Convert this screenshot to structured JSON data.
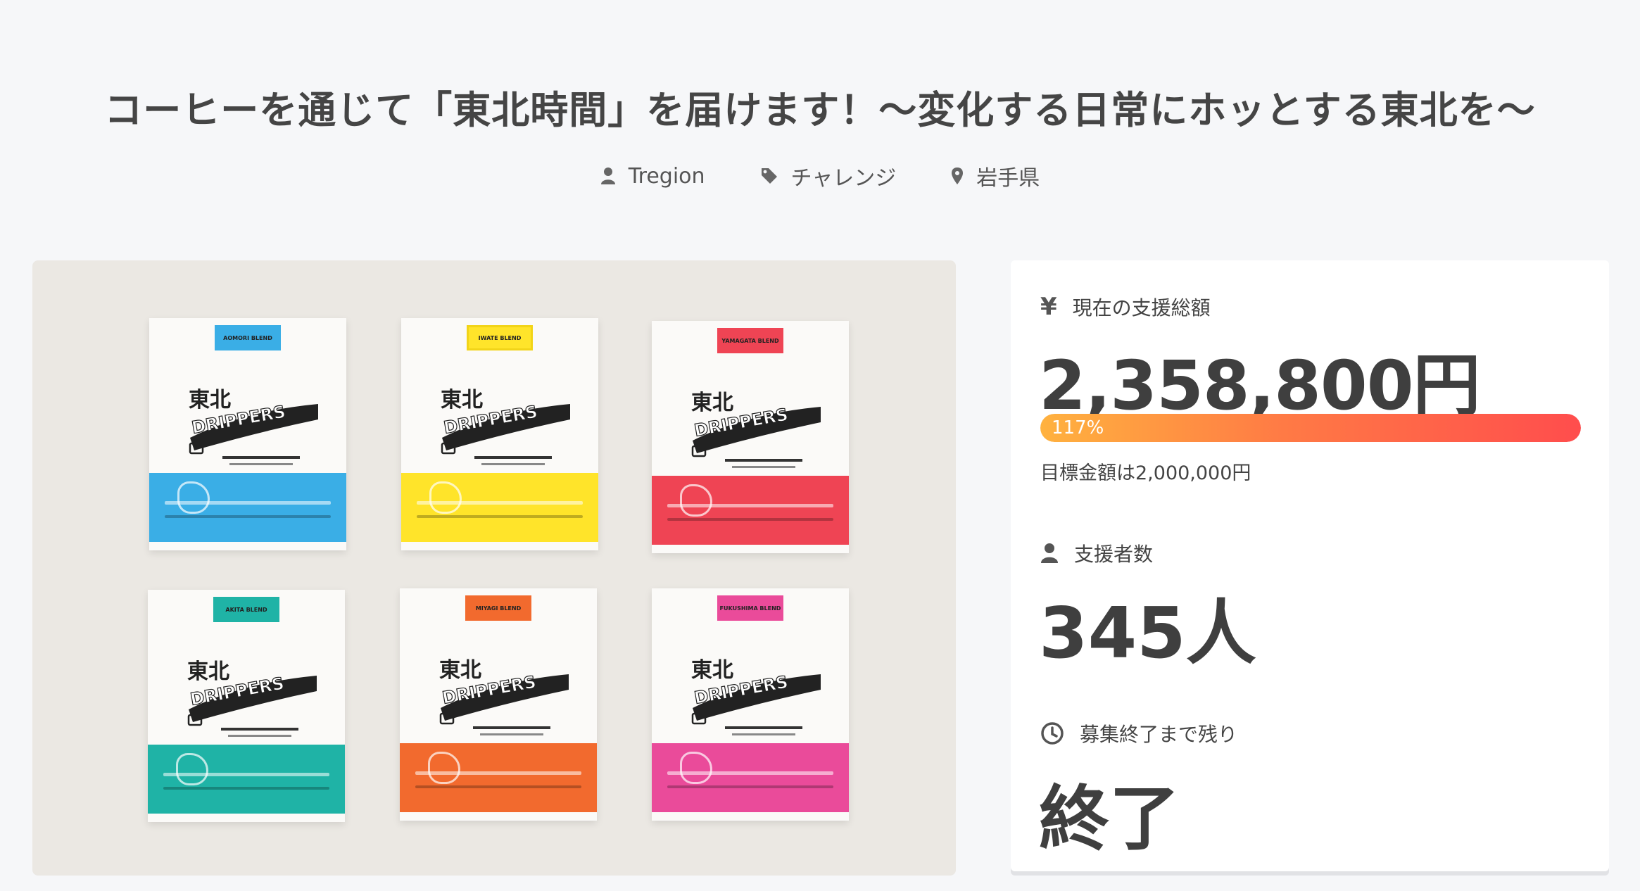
{
  "project": {
    "title": "コーヒーを通じて「東北時間」を届けます！〜変化する日常にホッとする東北を〜",
    "owner": "Tregion",
    "category": "チャレンジ",
    "location": "岩手県"
  },
  "hero": {
    "packages": [
      {
        "tag": "AOMORI BLEND",
        "color": "#3aaee6",
        "tag_border": "#3aaee6"
      },
      {
        "tag": "IWATE BLEND",
        "color": "#ffe42a",
        "tag_border": "#f2d418"
      },
      {
        "tag": "YAMAGATA BLEND",
        "color": "#ef4454",
        "tag_border": "#ef4454"
      },
      {
        "tag": "AKITA BLEND",
        "color": "#1fb3a6",
        "tag_border": "#1fb3a6"
      },
      {
        "tag": "MIYAGI BLEND",
        "color": "#f26a2e",
        "tag_border": "#f26a2e"
      },
      {
        "tag": "FUKUSHIMA BLEND",
        "color": "#ea4b9a",
        "tag_border": "#ea4b9a"
      }
    ],
    "brand": "DRIPPERS",
    "brand_kanji": "東北"
  },
  "stats": {
    "amount_label": "現在の支援総額",
    "amount": "2,358,800円",
    "progress_text": "117%",
    "progress_value": 1.0,
    "goal": "目標金額は2,000,000円",
    "supporters_label": "支援者数",
    "supporters": "345人",
    "remaining_label": "募集終了まで残り",
    "remaining": "終了"
  },
  "colors": {
    "progress_start": "#ffb23f",
    "progress_end": "#ff4d4d",
    "text": "#3f3f3f"
  }
}
